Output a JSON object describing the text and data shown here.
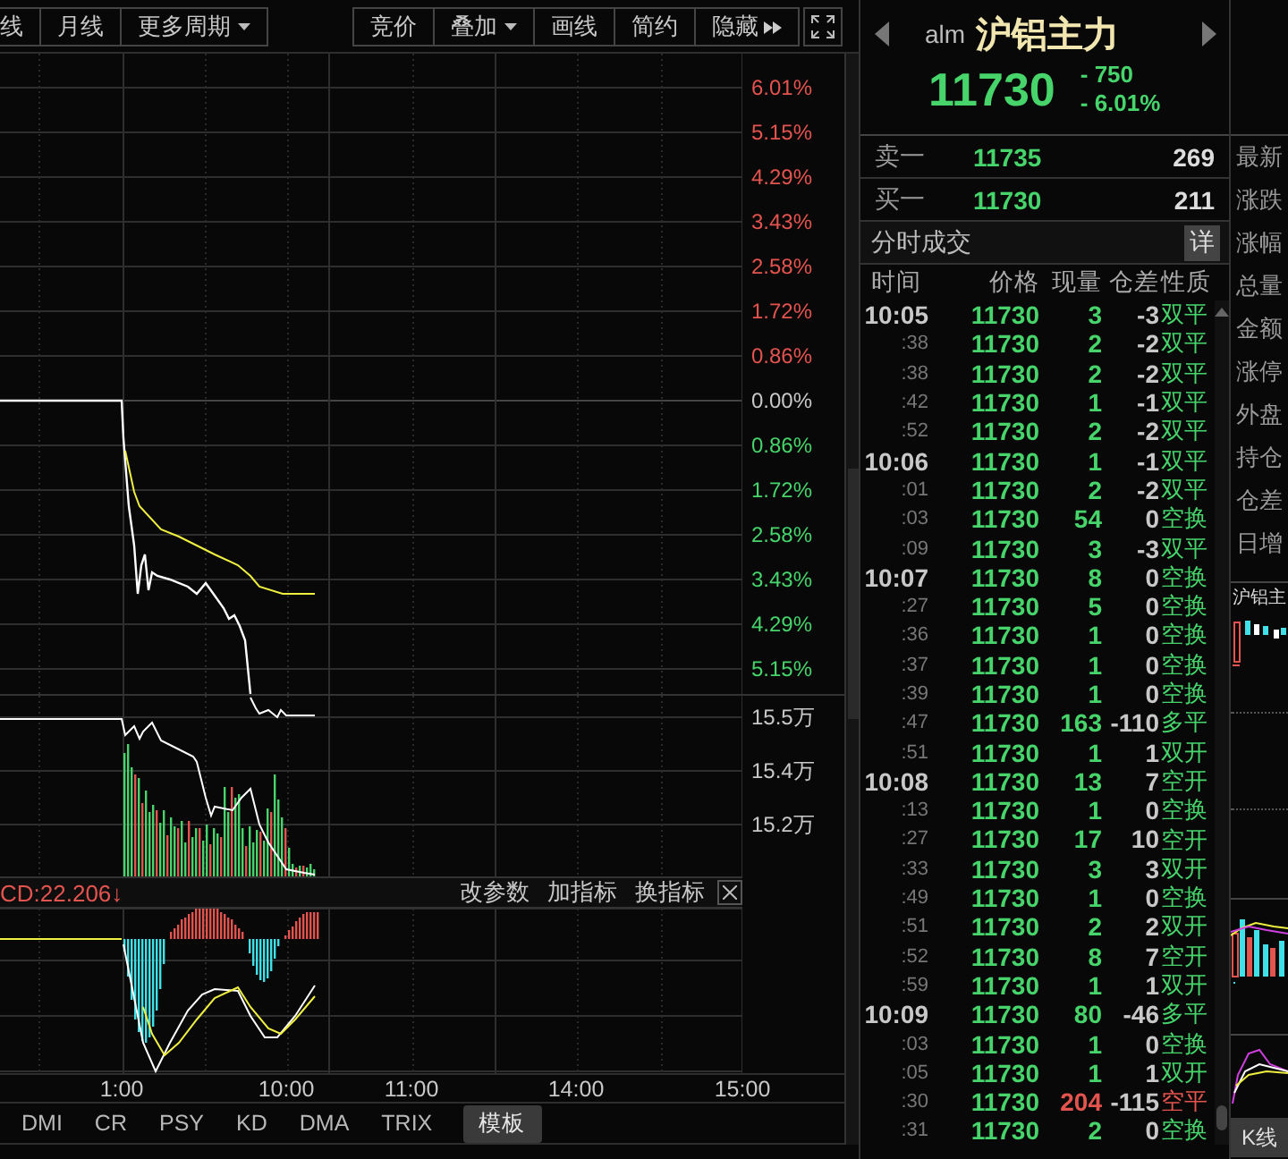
{
  "toolbar": {
    "left_buttons": [
      {
        "label": "线",
        "kind": "plain"
      },
      {
        "label": "月线",
        "kind": "plain"
      },
      {
        "label": "更多周期",
        "kind": "dropdown"
      }
    ],
    "right_buttons": [
      {
        "label": "竞价",
        "kind": "plain"
      },
      {
        "label": "叠加",
        "kind": "dropdown"
      },
      {
        "label": "画线",
        "kind": "plain"
      },
      {
        "label": "简约",
        "kind": "plain"
      },
      {
        "label": "隐藏",
        "kind": "expand"
      }
    ]
  },
  "price_chart": {
    "axis_labels": [
      {
        "text": "6.01%",
        "color": "#e4544f"
      },
      {
        "text": "5.15%",
        "color": "#e4544f"
      },
      {
        "text": "4.29%",
        "color": "#e4544f"
      },
      {
        "text": "3.43%",
        "color": "#e4544f"
      },
      {
        "text": "2.58%",
        "color": "#e4544f"
      },
      {
        "text": "1.72%",
        "color": "#e4544f"
      },
      {
        "text": "0.86%",
        "color": "#e4544f"
      },
      {
        "text": "0.00%",
        "color": "#c8c8c8"
      },
      {
        "text": "0.86%",
        "color": "#46d46b"
      },
      {
        "text": "1.72%",
        "color": "#46d46b"
      },
      {
        "text": "2.58%",
        "color": "#46d46b"
      },
      {
        "text": "3.43%",
        "color": "#46d46b"
      },
      {
        "text": "4.29%",
        "color": "#46d46b"
      },
      {
        "text": "5.15%",
        "color": "#46d46b"
      }
    ]
  },
  "volume_chart": {
    "axis_labels": [
      "15.5万",
      "15.4万",
      "15.2万"
    ]
  },
  "macd": {
    "value_label": "CD:22.206↓",
    "actions": [
      "改参数",
      "加指标",
      "换指标"
    ]
  },
  "time_axis": [
    "1:00",
    "10:00",
    "11:00",
    "14:00",
    "15:00"
  ],
  "indicator_tabs": [
    {
      "label": "DMI",
      "selected": false
    },
    {
      "label": "CR",
      "selected": false
    },
    {
      "label": "PSY",
      "selected": false
    },
    {
      "label": "KD",
      "selected": false
    },
    {
      "label": "DMA",
      "selected": false
    },
    {
      "label": "TRIX",
      "selected": false
    },
    {
      "label": "模板",
      "selected": true
    }
  ],
  "quote": {
    "code": "alm",
    "name": "沪铝主力",
    "price": "11730",
    "change": "- 750",
    "change_pct": "- 6.01%"
  },
  "order_book": [
    {
      "label": "卖一",
      "price": "11735",
      "volume": "269"
    },
    {
      "label": "买一",
      "price": "11730",
      "volume": "211"
    }
  ],
  "trades": {
    "title": "分时成交",
    "detail_button": "详",
    "columns": [
      "时间",
      "价格",
      "现量",
      "仓差",
      "性质"
    ],
    "rows": [
      {
        "time": "10:05",
        "kind": "minute",
        "price": "11730",
        "volume": "3",
        "oi_change": "-3",
        "nature": "双平",
        "color": "#46d46b"
      },
      {
        "time": ":38",
        "kind": "second",
        "price": "11730",
        "volume": "2",
        "oi_change": "-2",
        "nature": "双平",
        "color": "#46d46b"
      },
      {
        "time": ":38",
        "kind": "second",
        "price": "11730",
        "volume": "2",
        "oi_change": "-2",
        "nature": "双平",
        "color": "#46d46b"
      },
      {
        "time": ":42",
        "kind": "second",
        "price": "11730",
        "volume": "1",
        "oi_change": "-1",
        "nature": "双平",
        "color": "#46d46b"
      },
      {
        "time": ":52",
        "kind": "second",
        "price": "11730",
        "volume": "2",
        "oi_change": "-2",
        "nature": "双平",
        "color": "#46d46b"
      },
      {
        "time": "10:06",
        "kind": "minute",
        "price": "11730",
        "volume": "1",
        "oi_change": "-1",
        "nature": "双平",
        "color": "#46d46b"
      },
      {
        "time": ":01",
        "kind": "second",
        "price": "11730",
        "volume": "2",
        "oi_change": "-2",
        "nature": "双平",
        "color": "#46d46b"
      },
      {
        "time": ":03",
        "kind": "second",
        "price": "11730",
        "volume": "54",
        "oi_change": "0",
        "nature": "空换",
        "color": "#46d46b"
      },
      {
        "time": ":09",
        "kind": "second",
        "price": "11730",
        "volume": "3",
        "oi_change": "-3",
        "nature": "双平",
        "color": "#46d46b"
      },
      {
        "time": "10:07",
        "kind": "minute",
        "price": "11730",
        "volume": "8",
        "oi_change": "0",
        "nature": "空换",
        "color": "#46d46b"
      },
      {
        "time": ":27",
        "kind": "second",
        "price": "11730",
        "volume": "5",
        "oi_change": "0",
        "nature": "空换",
        "color": "#46d46b"
      },
      {
        "time": ":36",
        "kind": "second",
        "price": "11730",
        "volume": "1",
        "oi_change": "0",
        "nature": "空换",
        "color": "#46d46b"
      },
      {
        "time": ":37",
        "kind": "second",
        "price": "11730",
        "volume": "1",
        "oi_change": "0",
        "nature": "空换",
        "color": "#46d46b"
      },
      {
        "time": ":39",
        "kind": "second",
        "price": "11730",
        "volume": "1",
        "oi_change": "0",
        "nature": "空换",
        "color": "#46d46b"
      },
      {
        "time": ":47",
        "kind": "second",
        "price": "11730",
        "volume": "163",
        "oi_change": "-110",
        "nature": "多平",
        "color": "#46d46b"
      },
      {
        "time": ":51",
        "kind": "second",
        "price": "11730",
        "volume": "1",
        "oi_change": "1",
        "nature": "双开",
        "color": "#46d46b"
      },
      {
        "time": "10:08",
        "kind": "minute",
        "price": "11730",
        "volume": "13",
        "oi_change": "7",
        "nature": "空开",
        "color": "#46d46b"
      },
      {
        "time": ":13",
        "kind": "second",
        "price": "11730",
        "volume": "1",
        "oi_change": "0",
        "nature": "空换",
        "color": "#46d46b"
      },
      {
        "time": ":27",
        "kind": "second",
        "price": "11730",
        "volume": "17",
        "oi_change": "10",
        "nature": "空开",
        "color": "#46d46b"
      },
      {
        "time": ":33",
        "kind": "second",
        "price": "11730",
        "volume": "3",
        "oi_change": "3",
        "nature": "双开",
        "color": "#46d46b"
      },
      {
        "time": ":49",
        "kind": "second",
        "price": "11730",
        "volume": "1",
        "oi_change": "0",
        "nature": "空换",
        "color": "#46d46b"
      },
      {
        "time": ":51",
        "kind": "second",
        "price": "11730",
        "volume": "2",
        "oi_change": "2",
        "nature": "双开",
        "color": "#46d46b"
      },
      {
        "time": ":52",
        "kind": "second",
        "price": "11730",
        "volume": "8",
        "oi_change": "7",
        "nature": "空开",
        "color": "#46d46b"
      },
      {
        "time": ":59",
        "kind": "second",
        "price": "11730",
        "volume": "1",
        "oi_change": "1",
        "nature": "双开",
        "color": "#46d46b"
      },
      {
        "time": "10:09",
        "kind": "minute",
        "price": "11730",
        "volume": "80",
        "oi_change": "-46",
        "nature": "多平",
        "color": "#46d46b"
      },
      {
        "time": ":03",
        "kind": "second",
        "price": "11730",
        "volume": "1",
        "oi_change": "0",
        "nature": "空换",
        "color": "#46d46b"
      },
      {
        "time": ":05",
        "kind": "second",
        "price": "11730",
        "volume": "1",
        "oi_change": "1",
        "nature": "双开",
        "color": "#46d46b"
      },
      {
        "time": ":30",
        "kind": "second",
        "price": "11730",
        "volume": "204",
        "oi_change": "-115",
        "nature": "空平",
        "color": "#e4544f"
      },
      {
        "time": ":31",
        "kind": "second",
        "price": "11730",
        "volume": "2",
        "oi_change": "0",
        "nature": "空换",
        "color": "#46d46b"
      }
    ]
  },
  "side_panel": {
    "labels": [
      "最新",
      "涨跌",
      "涨幅",
      "总量",
      "金额",
      "涨停",
      "外盘",
      "持仓",
      "仓差",
      "日增"
    ],
    "mini_chart_title": "沪铝主",
    "kline_button": "K线"
  }
}
